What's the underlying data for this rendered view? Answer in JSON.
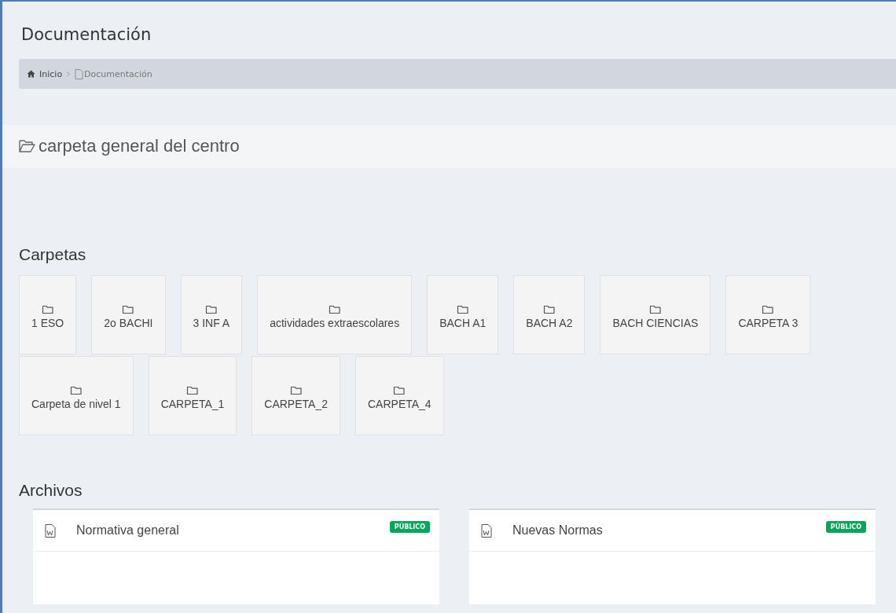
{
  "page_title": "Documentación",
  "breadcrumb": [
    {
      "label": "Inicio",
      "kind": "home"
    },
    {
      "label": "Documentación",
      "kind": "page"
    }
  ],
  "current_folder": "carpeta general del centro",
  "folders_heading": "Carpetas",
  "folders": [
    {
      "name": "1 ESO"
    },
    {
      "name": "2o BACHI"
    },
    {
      "name": "3 INF A"
    },
    {
      "name": "actividades extraescolares"
    },
    {
      "name": "BACH A1"
    },
    {
      "name": "BACH A2"
    },
    {
      "name": "BACH CIENCIAS"
    },
    {
      "name": "CARPETA 3"
    },
    {
      "name": "Carpeta de nivel 1"
    },
    {
      "name": "CARPETA_1"
    },
    {
      "name": "CARPETA_2"
    },
    {
      "name": "CARPETA_4"
    }
  ],
  "files_heading": "Archivos",
  "files": [
    {
      "title": "Normativa general",
      "badge": "PÚBLICO",
      "kind": "word"
    },
    {
      "title": "Nuevas Normas",
      "badge": "PÚBLICO",
      "kind": "word"
    }
  ]
}
